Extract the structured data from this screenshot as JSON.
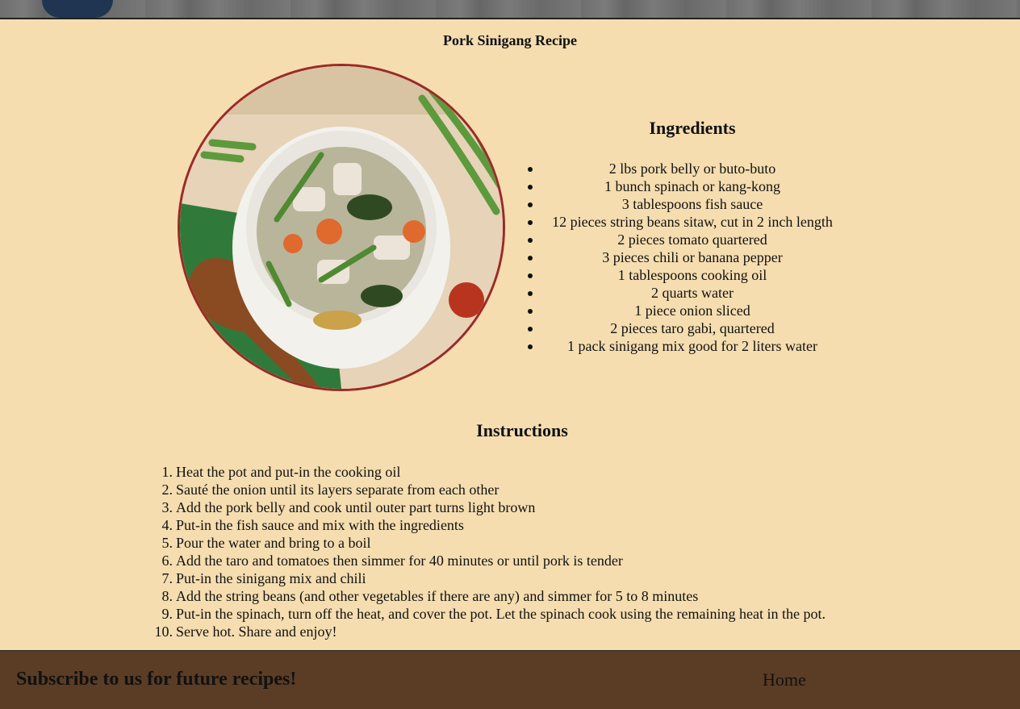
{
  "page": {
    "title": "Pork Sinigang Recipe"
  },
  "image": {
    "alt": "Pork Sinigang"
  },
  "ingredients": {
    "heading": "Ingredients",
    "items": [
      "2 lbs pork belly or buto-buto",
      "1 bunch spinach or kang-kong",
      "3 tablespoons fish sauce",
      "12 pieces string beans sitaw, cut in 2 inch length",
      "2 pieces tomato quartered",
      "3 pieces chili or banana pepper",
      "1 tablespoons cooking oil",
      "2 quarts water",
      "1 piece onion sliced",
      "2 pieces taro gabi, quartered",
      "1 pack sinigang mix good for 2 liters water"
    ]
  },
  "instructions": {
    "heading": "Instructions",
    "steps": [
      "Heat the pot and put-in the cooking oil",
      "Sauté the onion until its layers separate from each other",
      "Add the pork belly and cook until outer part turns light brown",
      "Put-in the fish sauce and mix with the ingredients",
      "Pour the water and bring to a boil",
      "Add the taro and tomatoes then simmer for 40 minutes or until pork is tender",
      "Put-in the sinigang mix and chili",
      "Add the string beans (and other vegetables if there are any) and simmer for 5 to 8 minutes",
      "Put-in the spinach, turn off the heat, and cover the pot. Let the spinach cook using the remaining heat in the pot.",
      "Serve hot. Share and enjoy!"
    ]
  },
  "footer": {
    "subscribe": "Subscribe to us for future recipes!",
    "home_link": "Home"
  },
  "colors": {
    "page_bg": "#f5ddb0",
    "footer_bg": "#5b3d25",
    "photo_border": "#9c2a26"
  }
}
